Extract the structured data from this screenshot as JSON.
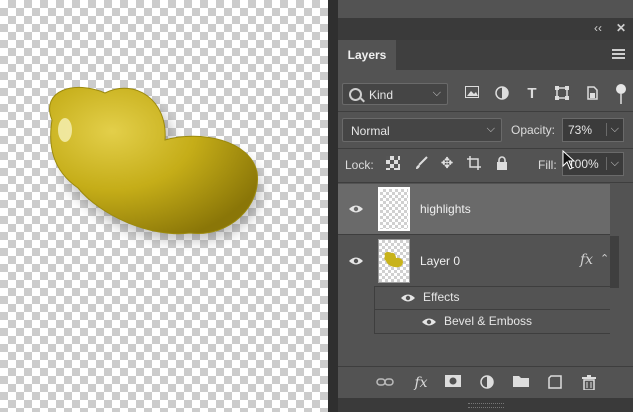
{
  "panel": {
    "collapse_label": "‹‹",
    "close_label": "✕",
    "tab_label": "Layers",
    "filter_kind": "Kind",
    "blend_mode": "Normal",
    "opacity_label": "Opacity:",
    "opacity_value": "73%",
    "lock_label": "Lock:",
    "fill_label": "Fill:",
    "fill_value": "100%"
  },
  "layers": [
    {
      "name": "highlights",
      "selected": true
    },
    {
      "name": "Layer 0",
      "selected": false,
      "fx": "fx"
    }
  ],
  "effects": {
    "group_label": "Effects",
    "items": [
      "Bevel & Emboss"
    ]
  },
  "colors": {
    "blob": "#c8b31b",
    "panel_bg": "#535353",
    "selected_layer": "#6a6a6a"
  }
}
